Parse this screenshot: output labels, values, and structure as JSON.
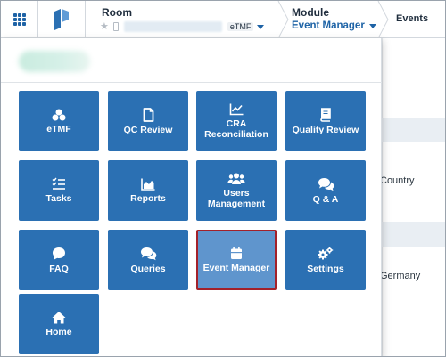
{
  "header": {
    "room": {
      "label": "Room",
      "tag": "eTMF"
    },
    "module": {
      "label": "Module",
      "value": "Event Manager"
    },
    "events_label": "Events"
  },
  "background": {
    "country_text": "Country",
    "germany_text": "Germany"
  },
  "menu": {
    "tiles": [
      {
        "label": "eTMF",
        "icon": "etmf-icon"
      },
      {
        "label": "QC Review",
        "icon": "document-icon"
      },
      {
        "label": "CRA Reconciliation",
        "icon": "line-chart-icon"
      },
      {
        "label": "Quality Review",
        "icon": "book-icon"
      },
      {
        "label": "Tasks",
        "icon": "checklist-icon"
      },
      {
        "label": "Reports",
        "icon": "area-chart-icon"
      },
      {
        "label": "Users Management",
        "icon": "users-icon"
      },
      {
        "label": "Q & A",
        "icon": "comments-icon"
      },
      {
        "label": "FAQ",
        "icon": "comment-icon"
      },
      {
        "label": "Queries",
        "icon": "comments-icon"
      },
      {
        "label": "Event Manager",
        "icon": "calendar-icon",
        "active": true
      },
      {
        "label": "Settings",
        "icon": "cogs-icon"
      },
      {
        "label": "Home",
        "icon": "home-icon"
      }
    ]
  },
  "colors": {
    "tile": "#2b70b3",
    "tile_active": "#5f95cd",
    "active_border": "#a3212a",
    "accent": "#1e63a6"
  }
}
